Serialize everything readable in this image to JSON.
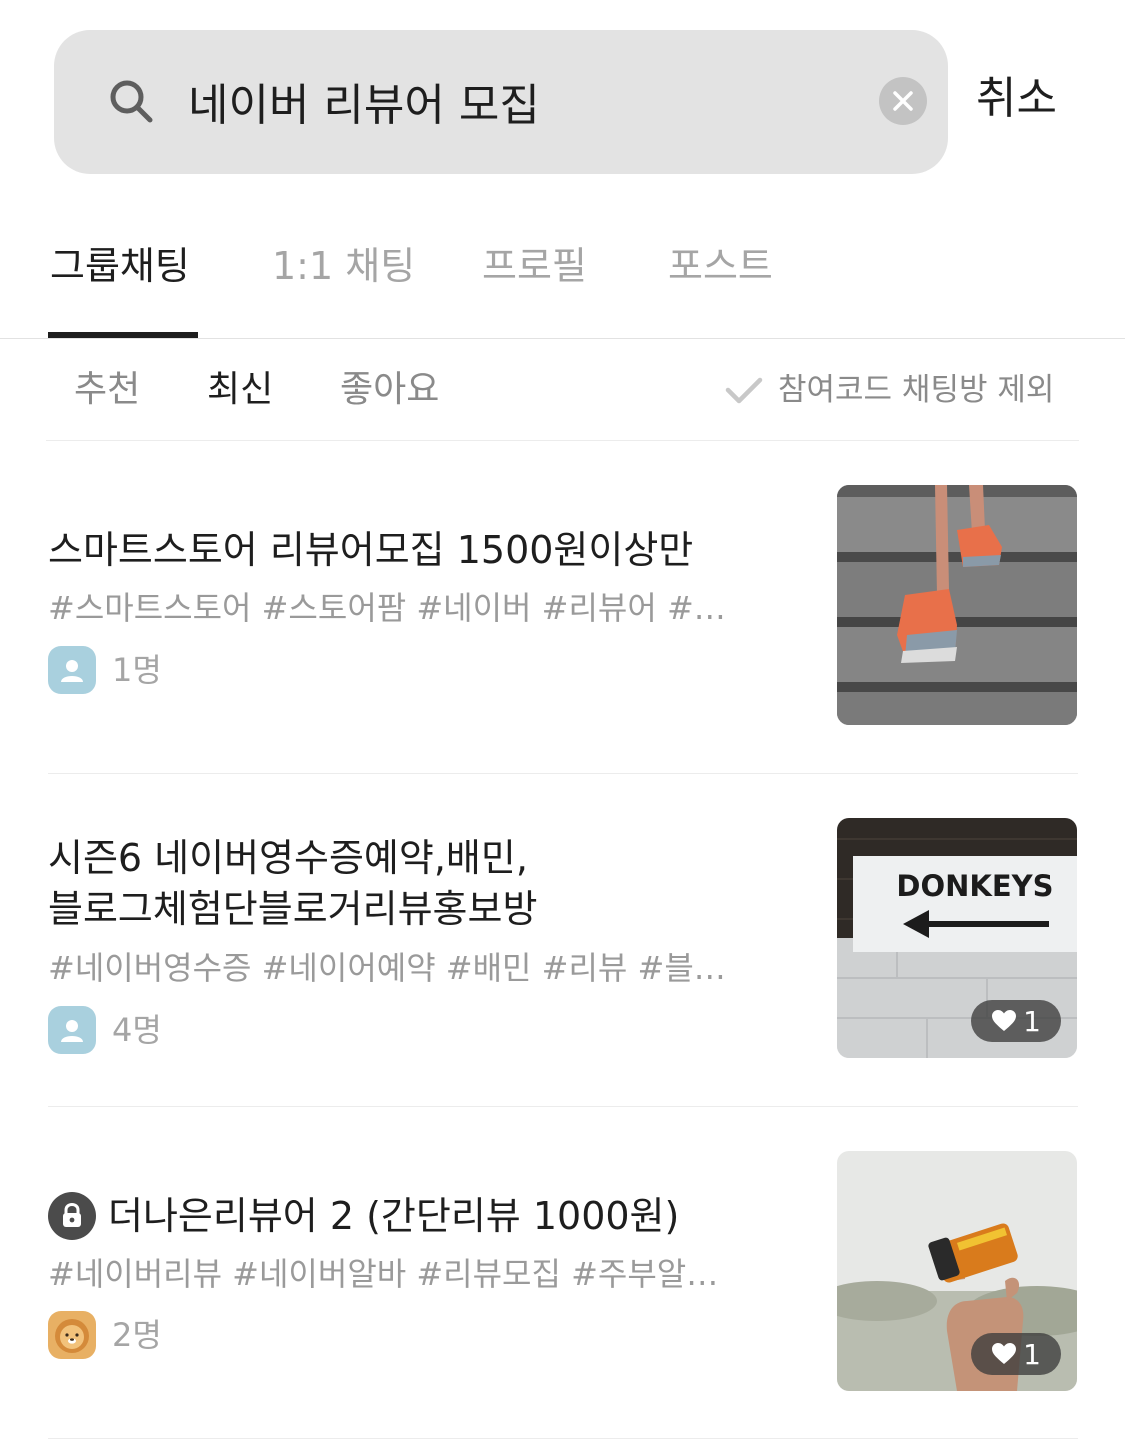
{
  "search": {
    "value": "네이버 리뷰어 모집",
    "cancel_label": "취소"
  },
  "tabs": [
    {
      "label": "그룹채팅",
      "active": true
    },
    {
      "label": "1:1 채팅",
      "active": false
    },
    {
      "label": "프로필",
      "active": false
    },
    {
      "label": "포스트",
      "active": false
    }
  ],
  "sort": {
    "options": [
      {
        "label": "추천",
        "active": false
      },
      {
        "label": "최신",
        "active": true
      },
      {
        "label": "좋아요",
        "active": false
      }
    ],
    "exclude_label": "참여코드 채팅방 제외"
  },
  "results": [
    {
      "title": "스마트스토어 리뷰어모집 1500원이상만",
      "tags": "#스마트스토어 #스토어팜 #네이버 #리뷰어 #…",
      "members": "1명",
      "avatar_icon": "person-icon",
      "thumbnail": "running-shoes-stairs",
      "likes": null,
      "locked": false
    },
    {
      "title_line1": "시즌6 네이버영수증예약,배민,",
      "title_line2": "블로그체험단블로거리뷰홍보방",
      "tags": "#네이버영수증 #네이어예약 #배민 #리뷰 #블…",
      "members": "4명",
      "avatar_icon": "person-icon",
      "thumbnail": "donkeys-sign",
      "thumbnail_text": "DONKEYS",
      "likes": "1",
      "locked": false
    },
    {
      "title": "더나은리뷰어 2 (간단리뷰 1000원)",
      "tags": "#네이버리뷰 #네이버알바 #리뷰모집 #주부알…",
      "members": "2명",
      "avatar_icon": "lion-icon",
      "thumbnail": "film-canister-hand",
      "likes": "1",
      "locked": true
    }
  ]
}
